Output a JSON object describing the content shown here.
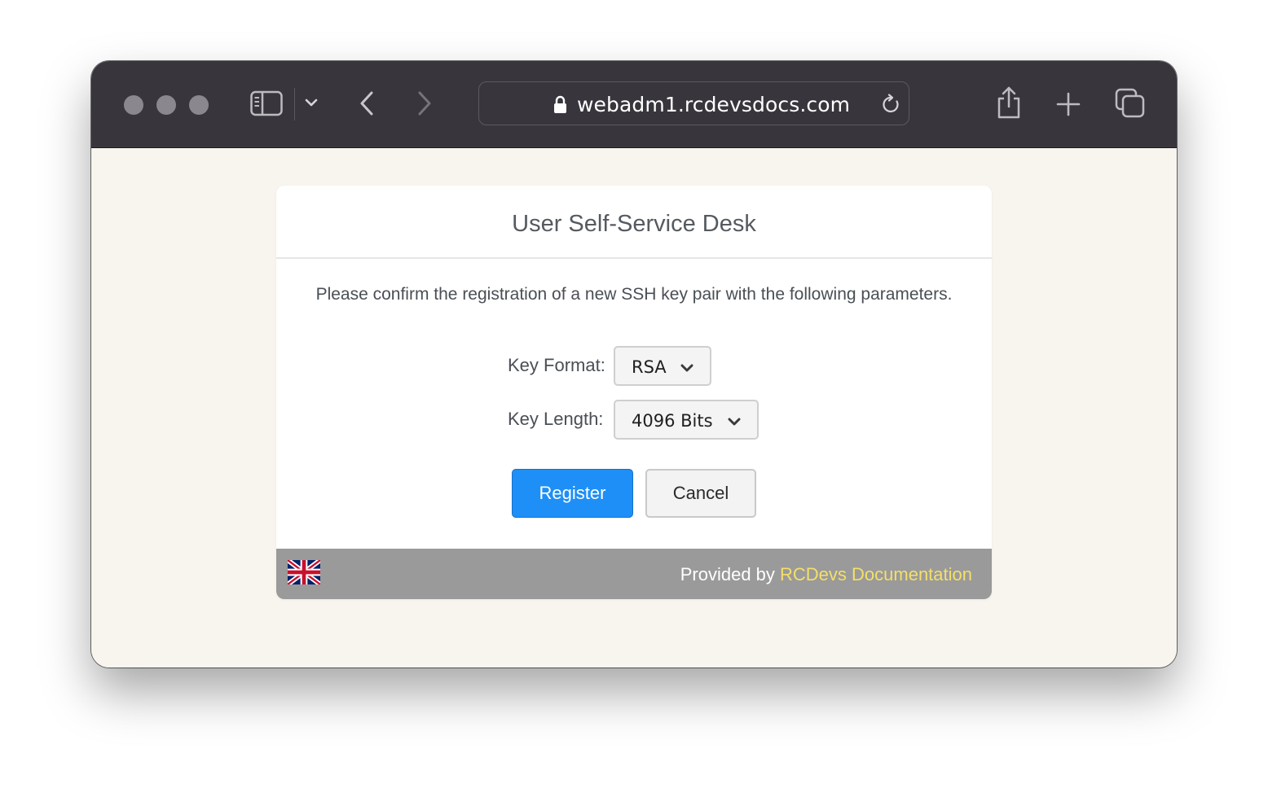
{
  "browser": {
    "url": "webadm1.rcdevsdocs.com",
    "icons": [
      "close-dot",
      "minimize-dot",
      "zoom-dot",
      "sidebar-icon",
      "chevron-down-icon",
      "back-icon",
      "forward-icon",
      "lock-icon",
      "reload-icon",
      "share-icon",
      "plus-icon",
      "tabs-overview-icon"
    ]
  },
  "page": {
    "title": "User Self-Service Desk",
    "message": "Please confirm the registration of a new SSH key pair with the following parameters.",
    "key_format": {
      "label": "Key Format:",
      "value": "RSA"
    },
    "key_length": {
      "label": "Key Length:",
      "value": "4096 Bits"
    },
    "register_label": "Register",
    "cancel_label": "Cancel",
    "footer": {
      "provided_by": "Provided by ",
      "link": "RCDevs Documentation",
      "language_flag": "uk-flag-icon"
    }
  },
  "colors": {
    "titlebar": "#38363c",
    "page_background": "#f8f4ee",
    "primary_button": "#1e8ff6",
    "footer_background": "#9a9a9a",
    "footer_link": "#f4df6a"
  }
}
